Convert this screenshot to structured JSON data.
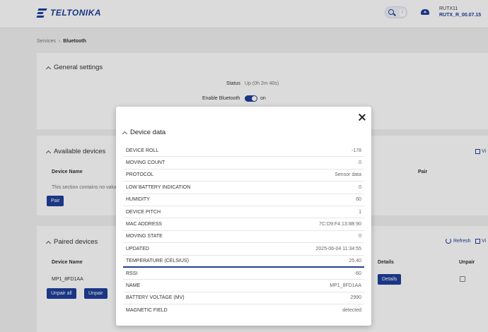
{
  "header": {
    "brand": "TELTONIKA",
    "search_shortcut": "/",
    "device_name": "RUTX11",
    "firmware": "RUTX_R_00.07.15"
  },
  "breadcrumb": {
    "parent": "Services",
    "current": "Bluetooth"
  },
  "general_settings": {
    "title": "General settings",
    "status_label": "Status",
    "status_value": "Up  (0h 2m 40s)",
    "enable_label": "Enable Bluetooth",
    "enable_value": "on"
  },
  "available_devices": {
    "title": "Available devices",
    "col_name": "Device Name",
    "col_pair": "Pair",
    "empty": "This section contains no value",
    "pair_button": "Pair",
    "view_link": "Vi"
  },
  "paired_devices": {
    "title": "Paired devices",
    "refresh": "Refresh",
    "view_link": "Vi",
    "col_name": "Device Name",
    "col_details": "Details",
    "col_unpair": "Unpair",
    "device": "MP1_8FD1AA",
    "details_button": "Details",
    "unpair_all_button": "Unpair all",
    "unpair_button": "Unpair"
  },
  "modal": {
    "title": "Device data",
    "rows": [
      {
        "key": "DEVICE ROLL",
        "value": "-178"
      },
      {
        "key": "MOVING COUNT",
        "value": "0"
      },
      {
        "key": "PROTOCOL",
        "value": "Sensor data"
      },
      {
        "key": "LOW BATTERY INDICATION",
        "value": "0"
      },
      {
        "key": "HUMIDITY",
        "value": "60"
      },
      {
        "key": "DEVICE PITCH",
        "value": "1"
      },
      {
        "key": "MAC ADDRESS",
        "value": "7C:D9:F4:13:8B:90"
      },
      {
        "key": "MOVING STATE",
        "value": "0"
      },
      {
        "key": "UPDATED",
        "value": "2025-06-04 11:34:55"
      },
      {
        "key": "TEMPERATURE (CELSIUS)",
        "value": "25.40"
      },
      {
        "key": "RSSI",
        "value": "-60"
      },
      {
        "key": "NAME",
        "value": "MP1_8FD1AA"
      },
      {
        "key": "BATTERY VOLTAGE (MV)",
        "value": "2990"
      },
      {
        "key": "MAGNETIC FIELD",
        "value": "detected"
      }
    ]
  }
}
